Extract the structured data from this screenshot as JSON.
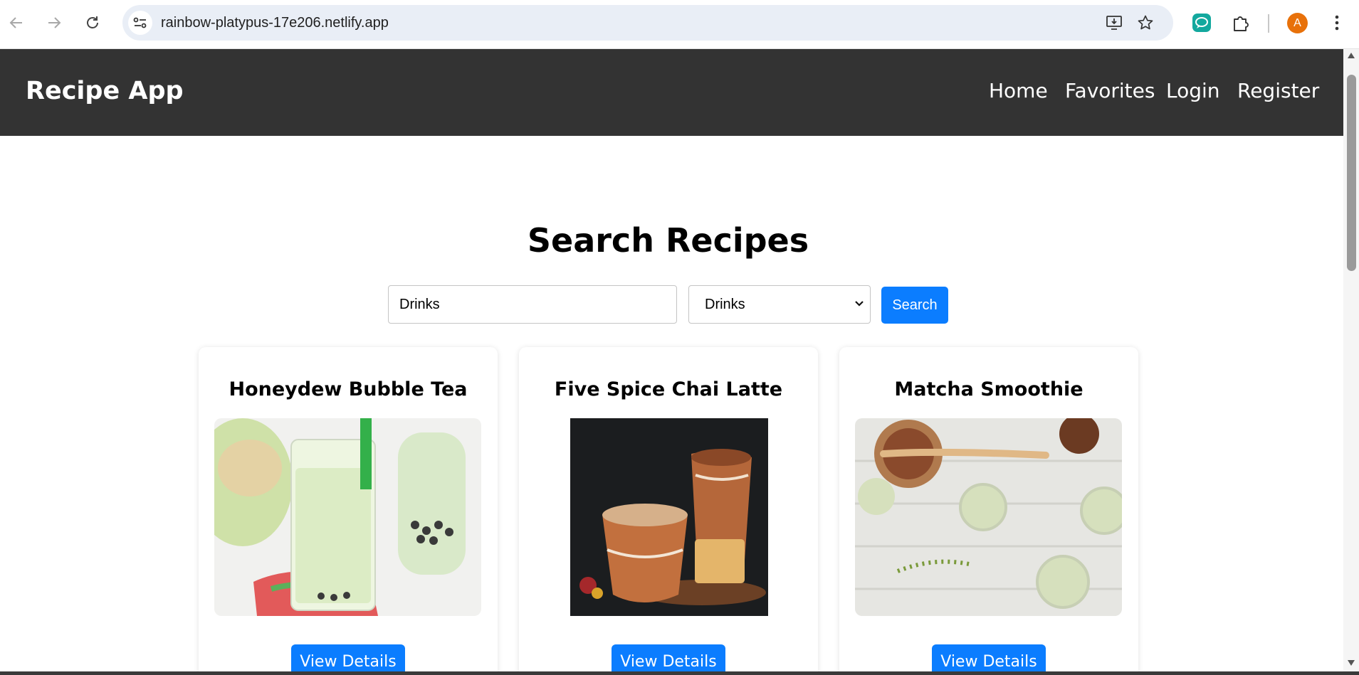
{
  "browser": {
    "url": "rainbow-platypus-17e206.netlify.app",
    "avatar_letter": "A",
    "icons": [
      "back-icon",
      "forward-icon",
      "reload-icon",
      "site-settings-icon",
      "install-app-icon",
      "bookmark-star-icon",
      "chat-extension-icon",
      "extensions-puzzle-icon",
      "more-menu-icon"
    ]
  },
  "header": {
    "brand": "Recipe App",
    "nav": [
      "Home",
      "Favorites",
      "Login",
      "Register"
    ],
    "background": "#333333"
  },
  "search": {
    "title": "Search Recipes",
    "query": "Drinks",
    "category": "Drinks",
    "button": "Search",
    "accent": "#0b7dff"
  },
  "recipes": [
    {
      "title": "Honeydew Bubble Tea",
      "button": "View Details"
    },
    {
      "title": "Five Spice Chai Latte",
      "button": "View Details"
    },
    {
      "title": "Matcha Smoothie",
      "button": "View Details"
    }
  ]
}
